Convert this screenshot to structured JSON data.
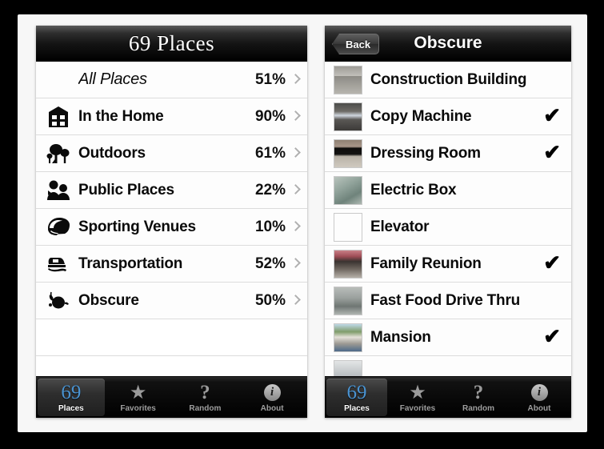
{
  "left_screen": {
    "navbar": {
      "title": "69 Places"
    },
    "rows": [
      {
        "icon": "none",
        "label": "All Places",
        "percent": "51%",
        "italic": true
      },
      {
        "icon": "house-icon",
        "label": "In the Home",
        "percent": "90%",
        "italic": false
      },
      {
        "icon": "trees-icon",
        "label": "Outdoors",
        "percent": "61%",
        "italic": false
      },
      {
        "icon": "people-icon",
        "label": "Public Places",
        "percent": "22%",
        "italic": false
      },
      {
        "icon": "helmet-icon",
        "label": "Sporting Venues",
        "percent": "10%",
        "italic": false
      },
      {
        "icon": "car-icon",
        "label": "Transportation",
        "percent": "52%",
        "italic": false
      },
      {
        "icon": "obscure-icon",
        "label": "Obscure",
        "percent": "50%",
        "italic": false
      }
    ],
    "tabs": [
      {
        "icon": "places-69-icon",
        "label": "Places",
        "selected": true
      },
      {
        "icon": "star-icon",
        "label": "Favorites",
        "selected": false
      },
      {
        "icon": "question-icon",
        "label": "Random",
        "selected": false
      },
      {
        "icon": "info-icon",
        "label": "About",
        "selected": false
      }
    ],
    "tab_badge_number": "69"
  },
  "right_screen": {
    "navbar": {
      "back_label": "Back",
      "title": "Obscure"
    },
    "rows": [
      {
        "thumb": "th-construction",
        "label": "Construction Building",
        "checked": false
      },
      {
        "thumb": "th-copy",
        "label": "Copy Machine",
        "checked": true
      },
      {
        "thumb": "th-dressing",
        "label": "Dressing Room",
        "checked": true
      },
      {
        "thumb": "th-electric",
        "label": "Electric Box",
        "checked": false
      },
      {
        "thumb": "th-elevator",
        "label": "Elevator",
        "checked": false
      },
      {
        "thumb": "th-family",
        "label": "Family Reunion",
        "checked": true
      },
      {
        "thumb": "th-fastfood",
        "label": "Fast Food Drive Thru",
        "checked": false
      },
      {
        "thumb": "th-mansion",
        "label": "Mansion",
        "checked": true
      }
    ],
    "tabs": [
      {
        "icon": "places-69-icon",
        "label": "Places",
        "selected": true
      },
      {
        "icon": "star-icon",
        "label": "Favorites",
        "selected": false
      },
      {
        "icon": "question-icon",
        "label": "Random",
        "selected": false
      },
      {
        "icon": "info-icon",
        "label": "About",
        "selected": false
      }
    ],
    "tab_badge_number": "69"
  },
  "glyphs": {
    "check_mark": "✔",
    "star": "★",
    "question": "?",
    "info": "i"
  }
}
